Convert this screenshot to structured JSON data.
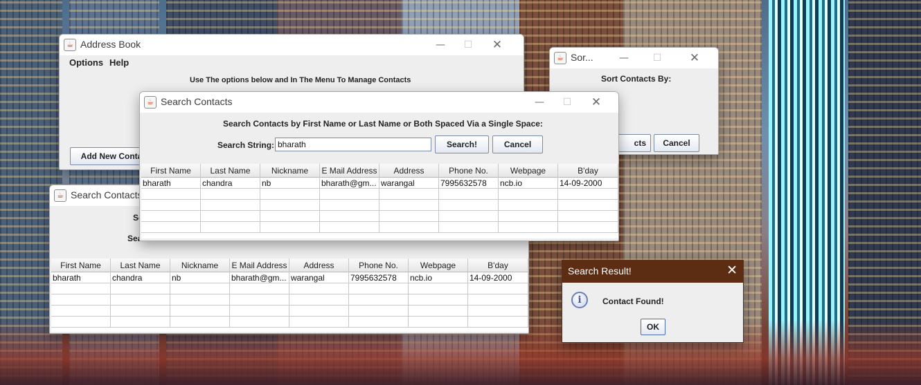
{
  "app_icon": "java-cup-icon",
  "windows": {
    "address_book": {
      "title": "Address Book",
      "menu": [
        "Options",
        "Help"
      ],
      "instructions": "Use The options below and In The Menu To Manage Contacts",
      "add_button": "Add New Conta"
    },
    "sort": {
      "title": "Sor...",
      "label": "Sort Contacts By:",
      "sort_button": "cts",
      "cancel_button": "Cancel"
    },
    "search_back": {
      "title": "Search Contacts",
      "label_fragment_1": "Se",
      "label_fragment_2": "Sea"
    },
    "search_front": {
      "title": "Search Contacts",
      "instructions": "Search Contacts by First Name or Last Name or Both Spaced Via a Single Space:",
      "search_label": "Search String:",
      "search_value": "bharath",
      "search_button": "Search!",
      "cancel_button": "Cancel"
    },
    "result_dialog": {
      "title": "Search Result!",
      "message": "Contact Found!",
      "ok_button": "OK"
    }
  },
  "table": {
    "columns": [
      "First Name",
      "Last Name",
      "Nickname",
      "E Mail Address",
      "Address",
      "Phone No.",
      "Webpage",
      "B'day"
    ],
    "rows": [
      [
        "bharath",
        "chandra",
        "nb",
        "bharath@gm...",
        "warangal",
        "7995632578",
        "ncb.io",
        "14-09-2000"
      ]
    ]
  }
}
